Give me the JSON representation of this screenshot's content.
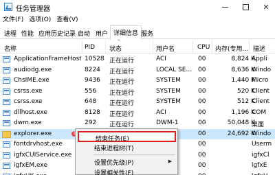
{
  "window": {
    "title": "任务管理器",
    "controls": {
      "minimize": "",
      "maximize": "",
      "close": "✕"
    }
  },
  "menubar": [
    "文件(F)",
    "选项(O)",
    "查看(V)"
  ],
  "tabs": [
    "进程",
    "性能",
    "应用历史记录",
    "启动",
    "用户",
    "详细信息",
    "服务"
  ],
  "active_tab": "详细信息",
  "columns": {
    "name": "名称",
    "pid": "PID",
    "status": "状态",
    "user": "用户名",
    "cpu": "CPU",
    "memory": "内存(专用...",
    "description": "描述",
    "sort_indicator": "^"
  },
  "rows": [
    {
      "name": "ApplicationFrameHost...",
      "pid": "10528",
      "status": "正在运行",
      "user": "ACI",
      "cpu": "00",
      "memory": "8,824 K",
      "desc": "Appli"
    },
    {
      "name": "audiodg.exe",
      "pid": "8224",
      "status": "正在运行",
      "user": "LOCAL SE...",
      "cpu": "00",
      "memory": "8,636 K",
      "desc": "Windo"
    },
    {
      "name": "ChsIME.exe",
      "pid": "9436",
      "status": "正在运行",
      "user": "SYSTEM",
      "cpu": "00",
      "memory": "1,440 K",
      "desc": "Micro"
    },
    {
      "name": "csrss.exe",
      "pid": "556",
      "status": "正在运行",
      "user": "SYSTEM",
      "cpu": "00",
      "memory": "520 K",
      "desc": "Client"
    },
    {
      "name": "csrss.exe",
      "pid": "648",
      "status": "正在运行",
      "user": "SYSTEM",
      "cpu": "00",
      "memory": "512 K",
      "desc": "Client"
    },
    {
      "name": "dllhost.exe",
      "pid": "8128",
      "status": "正在运行",
      "user": "ACI",
      "cpu": "00",
      "memory": "1,196 K",
      "desc": "COM"
    },
    {
      "name": "dwm.exe",
      "pid": "292",
      "status": "正在运行",
      "user": "DWM-1",
      "cpu": "00",
      "memory": "50,048 K",
      "desc": "桌面"
    },
    {
      "name": "explorer.exe",
      "pid": "3068",
      "status": "正在运行",
      "user": "ACI",
      "cpu": "00",
      "memory": "24,692 K",
      "desc": "Windo",
      "selected": true,
      "badge": "1"
    },
    {
      "name": "fontdrvhost.exe",
      "pid": "",
      "status": "",
      "user": "",
      "cpu": "00",
      "memory": "",
      "desc": "Userm"
    },
    {
      "name": "igfxCUIService.exe",
      "pid": "",
      "status": "",
      "user": "",
      "cpu": "00",
      "memory": "",
      "desc": "igfxCl"
    },
    {
      "name": "igfxEM.exe",
      "pid": "",
      "status": "",
      "user": "",
      "cpu": "00",
      "memory": "",
      "desc": "igfxE"
    },
    {
      "name": "igfxHK.exe",
      "pid": "",
      "status": "",
      "user": "",
      "cpu": "00",
      "memory": "",
      "desc": "igfxH"
    }
  ],
  "context_menu": {
    "end_task": "结束任务(E)",
    "end_tree": "结束进程树(T)",
    "set_priority": "设置优先级(P)",
    "set_affinity": "设置相关性(F)"
  },
  "colors": {
    "selection": "#cce8ff",
    "highlight_border": "#e02020",
    "memory_column": "#fff4c4"
  }
}
